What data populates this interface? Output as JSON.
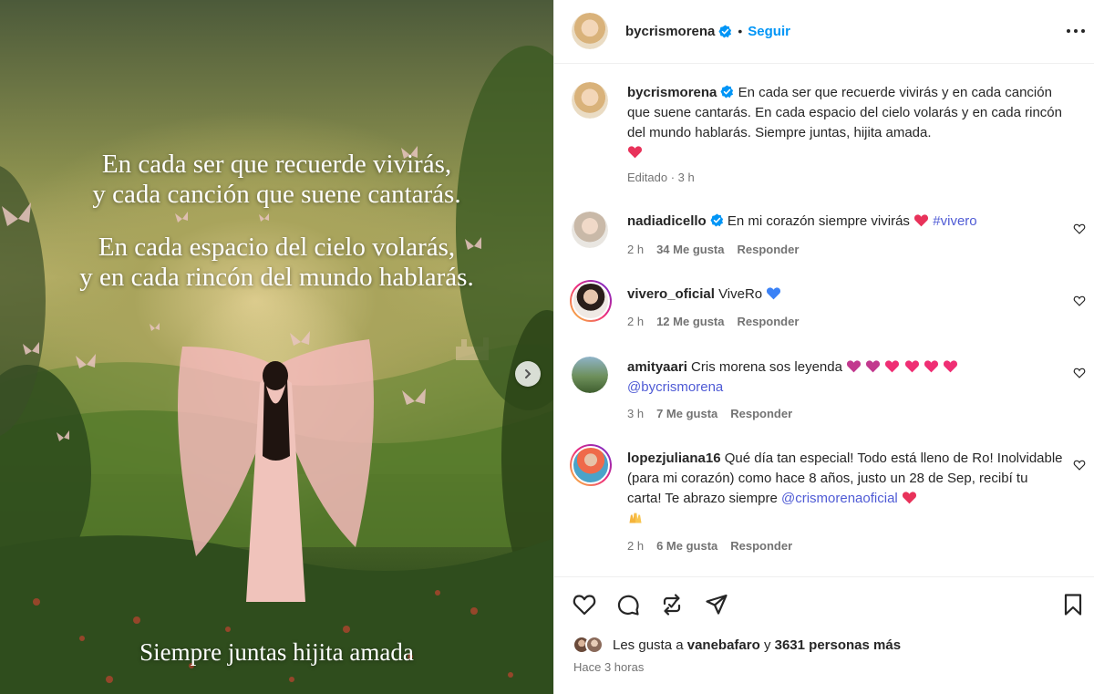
{
  "media": {
    "quote_lines_1": [
      "En cada ser que recuerde vivirás,",
      "y cada canción que suene cantarás."
    ],
    "quote_lines_2": [
      "En cada espacio del cielo volarás,",
      "y en cada rincón del mundo hablarás."
    ],
    "footer_line": "Siempre juntas hijita amada"
  },
  "header": {
    "username": "bycrismorena",
    "separator": "•",
    "follow_label": "Seguir"
  },
  "caption": {
    "username": "bycrismorena",
    "text": "En cada ser que recuerde vivirás y en cada canción que suene cantarás. En cada espacio del cielo volarás y en cada rincón del mundo hablarás. Siempre juntas, hijita amada.",
    "meta": "Editado · 3 h"
  },
  "comments": [
    {
      "username": "nadiadicello",
      "text": "En mi corazón siempre vivirás",
      "hashtag": "#vivero",
      "time": "2 h",
      "likes": "34 Me gusta",
      "reply": "Responder"
    },
    {
      "username": "vivero_oficial",
      "text": "ViveRo",
      "time": "2 h",
      "likes": "12 Me gusta",
      "reply": "Responder"
    },
    {
      "username": "amityaari",
      "text": "Cris morena sos leyenda",
      "mention": "@bycrismorena",
      "time": "3 h",
      "likes": "7 Me gusta",
      "reply": "Responder"
    },
    {
      "username": "lopezjuliana16",
      "text": "Qué día tan especial! Todo está lleno de Ro! Inolvidable (para mi corazón) como hace 8 años, justo un 28 de Sep, recibí tu carta! Te abrazo siempre",
      "mention": "@crismorenaoficial",
      "time": "2 h",
      "likes": "6 Me gusta",
      "reply": "Responder"
    }
  ],
  "likes_line": {
    "prefix": "Les gusta a",
    "user": "vanebafaro",
    "connector": "y",
    "others": "3631 personas más"
  },
  "timestamp": "Hace 3 horas",
  "colors": {
    "accent": "#0095f6",
    "heart": "#ff3040",
    "link": "#00376b",
    "muted": "#737373"
  },
  "icons": [
    "more-options-icon",
    "verified-badge-icon",
    "heart-icon",
    "comment-icon",
    "repost-icon",
    "share-icon",
    "bookmark-icon",
    "chevron-right-icon"
  ]
}
